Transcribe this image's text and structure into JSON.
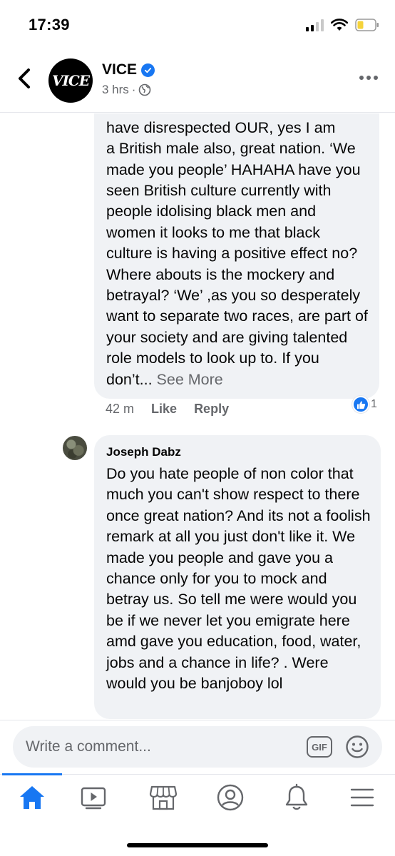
{
  "status_bar": {
    "time": "17:39"
  },
  "header": {
    "logo_text": "VICE",
    "page_name": "VICE",
    "post_age": "3 hrs",
    "separator": "·"
  },
  "comments": [
    {
      "partial_top_text": "have disrespected OUR, yes I am",
      "text": "a British male also, great nation. ‘We made you people’ HAHAHA have you seen British culture currently with people idolising black men and women it looks to me that black culture is having a positive effect no? Where abouts is the mockery and betrayal? ‘We’ ,as you so desperately want to separate two races, are part of your society and are giving talented role models to look up to. If you don’t...",
      "see_more": "See More",
      "time": "42 m",
      "like_label": "Like",
      "reply_label": "Reply",
      "reaction_count": "1"
    },
    {
      "author": "Joseph Dabz",
      "text": "Do you hate people of non color that much you can't show respect to there once great nation? And its not a foolish remark at all you just don't like it. We made you people and gave you a chance only for you to mock and betray us. So tell me were would you be if we never let you emigrate here amd gave you education, food, water, jobs and a chance in life? . Were would you be banjoboy lol"
    }
  ],
  "composer": {
    "placeholder": "Write a comment...",
    "gif_label": "GIF"
  },
  "tabs": [
    "home-icon",
    "watch-icon",
    "marketplace-icon",
    "profile-icon",
    "notifications-icon",
    "menu-icon"
  ],
  "colors": {
    "accent": "#1877f2",
    "bubble": "#f0f2f5",
    "secondary_text": "#65676b",
    "battery_low": "#f5d33b"
  }
}
